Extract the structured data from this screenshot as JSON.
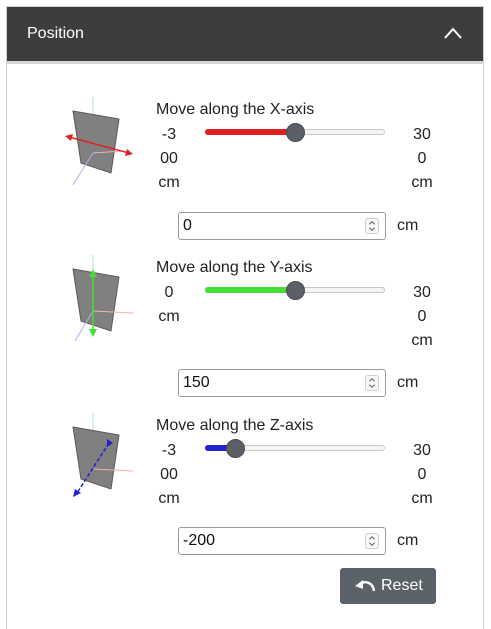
{
  "panel": {
    "title": "Position",
    "collapse_icon": "chevron-up-icon"
  },
  "axes": [
    {
      "title": "Move along the X-axis",
      "min_lines": [
        "-3",
        "00",
        "cm"
      ],
      "max_lines": [
        "30",
        "0",
        "cm"
      ],
      "min": -300,
      "max": 300,
      "value": 0,
      "input_value": "0",
      "unit": "cm",
      "color": "#e02020",
      "icon": "x-axis-move-icon"
    },
    {
      "title": "Move along the Y-axis",
      "min_lines": [
        "0",
        "cm"
      ],
      "max_lines": [
        "30",
        "0",
        "cm"
      ],
      "min": 0,
      "max": 300,
      "value": 150,
      "input_value": "150",
      "unit": "cm",
      "color": "#44dd33",
      "icon": "y-axis-move-icon"
    },
    {
      "title": "Move along the Z-axis",
      "min_lines": [
        "-3",
        "00",
        "cm"
      ],
      "max_lines": [
        "30",
        "0",
        "cm"
      ],
      "min": -300,
      "max": 300,
      "value": -200,
      "input_value": "-200",
      "unit": "cm",
      "color": "#2222cc",
      "icon": "z-axis-move-icon"
    }
  ],
  "reset": {
    "label": "Reset",
    "icon": "undo-icon"
  }
}
